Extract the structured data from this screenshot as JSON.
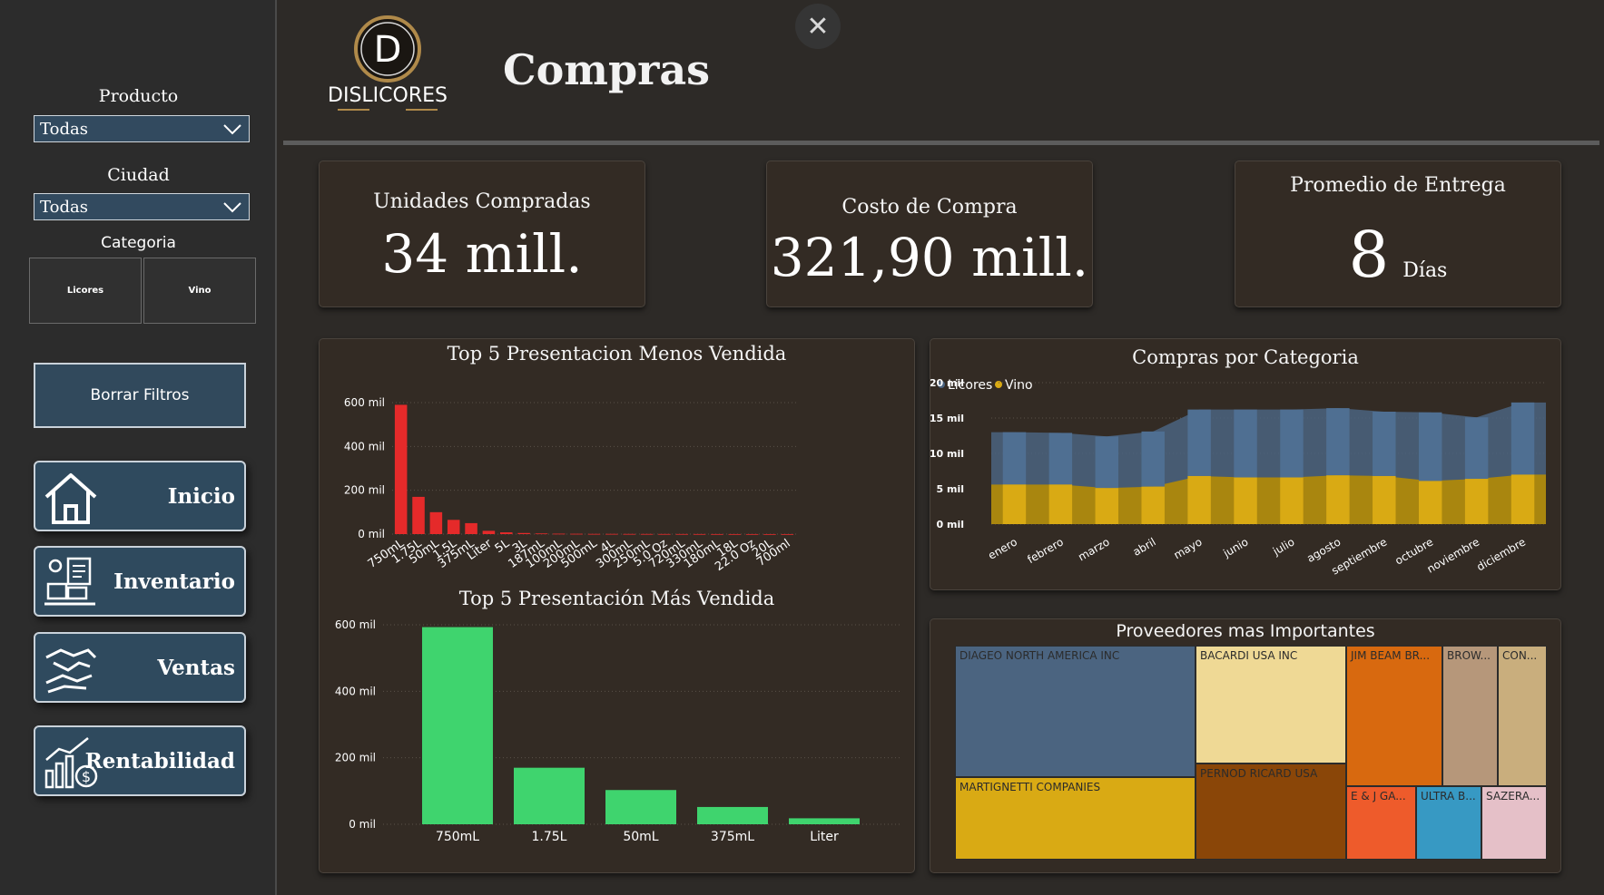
{
  "filters": {
    "product_label": "Producto",
    "product_value": "Todas",
    "city_label": "Ciudad",
    "city_value": "Todas",
    "category_label": "Categoria",
    "categories": [
      "Licores",
      "Vino"
    ],
    "clear_label": "Borrar Filtros"
  },
  "nav": {
    "items": [
      {
        "label": "Inicio",
        "icon": "home-icon"
      },
      {
        "label": "Inventario",
        "icon": "inventory-icon"
      },
      {
        "label": "Ventas",
        "icon": "handshake-icon"
      },
      {
        "label": "Rentabilidad",
        "icon": "profit-chart-icon"
      }
    ]
  },
  "header": {
    "logo_text": "DISLICORES",
    "logo_letter": "D",
    "title": "Compras",
    "close_icon": "close-icon"
  },
  "kpis": {
    "units_title": "Unidades Compradas",
    "units_value": "34 mill.",
    "cost_title": "Costo de Compra",
    "cost_value": "321,90 mill.",
    "delivery_title": "Promedio de Entrega",
    "delivery_value": "8",
    "delivery_unit": "Días"
  },
  "colors": {
    "red_bars": "#e52a2a",
    "green_bars": "#3fd46e",
    "licores": "#4b6480",
    "vino": "#d9aa14"
  },
  "chart_data": [
    {
      "type": "bar",
      "title": "Top 5 Presentacion Menos Vendida",
      "categories": [
        "750mL",
        "1.75L",
        "50mL",
        "1.5L",
        "375mL",
        "Liter",
        "5L",
        "3L",
        "187mL",
        "100mL",
        "200mL",
        "500mL",
        "4L",
        "300mL",
        "250mL",
        "5.0 Oz",
        "720mL",
        "330mL",
        "180mL",
        "18L",
        "22.0 Oz",
        "20L",
        "700ml"
      ],
      "values": [
        590,
        170,
        100,
        65,
        50,
        15,
        8,
        5,
        3,
        2,
        1.5,
        1,
        1,
        0.8,
        0.7,
        0.6,
        0.5,
        0.4,
        0.3,
        0.2,
        0.2,
        0.1,
        0.1
      ],
      "yticks": [
        "0 mil",
        "200 mil",
        "400 mil",
        "600 mil"
      ],
      "ylim": [
        0,
        600
      ]
    },
    {
      "type": "bar",
      "title": "Top 5 Presentación Más Vendida",
      "categories": [
        "750mL",
        "1.75L",
        "50mL",
        "375mL",
        "Liter"
      ],
      "values": [
        593,
        170,
        103,
        52,
        18
      ],
      "yticks": [
        "0 mil",
        "200 mil",
        "400 mil",
        "600 mil"
      ],
      "ylim": [
        0,
        600
      ]
    },
    {
      "type": "area",
      "title": "Compras por Categoria",
      "legend": [
        "Licores",
        "Vino"
      ],
      "categories": [
        "enero",
        "febrero",
        "marzo",
        "abril",
        "mayo",
        "junio",
        "julio",
        "agosto",
        "septiembre",
        "octubre",
        "noviembre",
        "diciembre"
      ],
      "series": [
        {
          "name": "Licores",
          "values": [
            13.0,
            12.9,
            12.4,
            13.1,
            16.2,
            16.2,
            16.2,
            16.4,
            15.9,
            15.8,
            15.1,
            17.2
          ]
        },
        {
          "name": "Vino",
          "values": [
            5.6,
            5.6,
            5.1,
            5.3,
            6.8,
            6.6,
            6.6,
            6.9,
            6.8,
            6.1,
            6.4,
            7.0
          ]
        }
      ],
      "yticks": [
        "0 mil",
        "5 mil",
        "10 mil",
        "15 mil",
        "20 mil"
      ],
      "ylim": [
        0,
        20
      ]
    },
    {
      "type": "treemap",
      "title": "Proveedores mas Importantes",
      "items": [
        {
          "label": "DIAGEO NORTH AMERICA INC",
          "color": "#4b6480"
        },
        {
          "label": "MARTIGNETTI COMPANIES",
          "color": "#d9aa14"
        },
        {
          "label": "BACARDI USA INC",
          "color": "#efd995"
        },
        {
          "label": "PERNOD RICARD USA",
          "color": "#8a4608"
        },
        {
          "label": "JIM BEAM BR...",
          "color": "#d8690f"
        },
        {
          "label": "BROW...",
          "color": "#b6977a"
        },
        {
          "label": "CON...",
          "color": "#c9ae7d"
        },
        {
          "label": "E & J GA...",
          "color": "#ee5b2b"
        },
        {
          "label": "ULTRA B...",
          "color": "#3799c3"
        },
        {
          "label": "SAZERA...",
          "color": "#e5c0c8"
        }
      ]
    }
  ]
}
